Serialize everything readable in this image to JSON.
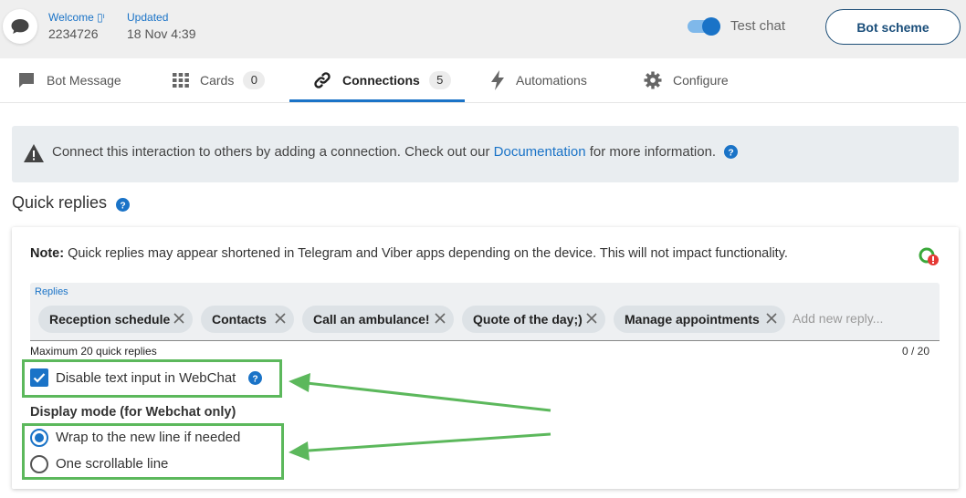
{
  "header": {
    "welcome_label": "Welcome ▯ᶦ",
    "user_id": "2234726",
    "updated_label": "Updated",
    "updated_value": "18 Nov 4:39",
    "test_chat_label": "Test chat",
    "test_chat_on": true,
    "bot_scheme_label": "Bot scheme"
  },
  "tabs": [
    {
      "label": "Bot Message",
      "icon": "chat-bubble-icon"
    },
    {
      "label": "Cards",
      "count": "0",
      "icon": "grid-icon"
    },
    {
      "label": "Connections",
      "count": "5",
      "icon": "link-icon",
      "active": true
    },
    {
      "label": "Automations",
      "icon": "lightning-icon"
    },
    {
      "label": "Configure",
      "icon": "gear-icon"
    }
  ],
  "alert": {
    "text_before": "Connect this interaction to others by adding a connection. Check out our ",
    "link": "Documentation",
    "text_after": " for more information."
  },
  "quick_replies": {
    "title": "Quick replies",
    "note_bold": "Note:",
    "note_text": " Quick replies may appear shortened in Telegram and Viber apps depending on the device. This will not impact functionality.",
    "field_label": "Replies",
    "chips": [
      "Reception schedule",
      "Contacts",
      "Call an ambulance!",
      "Quote of the day;)",
      "Manage appointments"
    ],
    "placeholder": "Add new reply...",
    "hint": "Maximum 20 quick replies",
    "counter": "0 / 20",
    "disable_text_input_label": "Disable text input in WebChat",
    "disable_text_input_checked": true,
    "display_mode_title": "Display mode (for Webchat only)",
    "display_modes": [
      {
        "label": "Wrap to the new line if needed",
        "selected": true
      },
      {
        "label": "One scrollable line",
        "selected": false
      }
    ]
  },
  "colors": {
    "accent": "#1a73c7",
    "annotation_green": "#5cb85c"
  }
}
